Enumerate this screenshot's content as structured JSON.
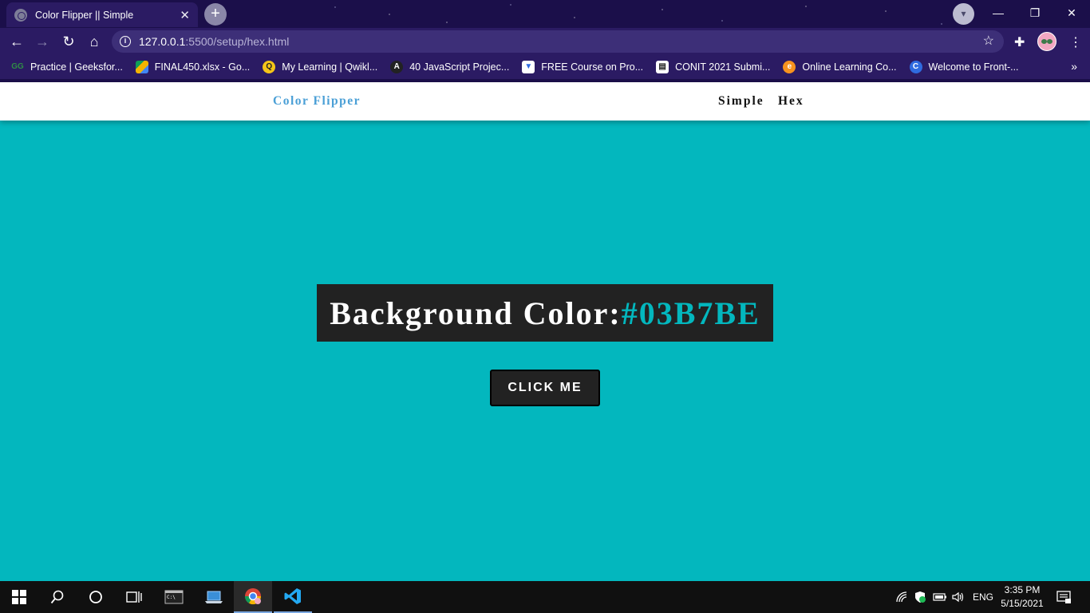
{
  "browser": {
    "tab_title": "Color Flipper || Simple",
    "tab_close": "✕",
    "new_tab": "+",
    "url_host": "127.0.0.1",
    "url_path": ":5500/setup/hex.html",
    "bookmarks": [
      {
        "label": "Practice | Geeksfor...",
        "icon": "geeksforgeeks-icon",
        "color": "#2f8d46"
      },
      {
        "label": "FINAL450.xlsx - Go...",
        "icon": "google-drive-icon",
        "color": "#f4b400"
      },
      {
        "label": "My Learning | Qwikl...",
        "icon": "qwiklabs-icon",
        "color": "#f5c518"
      },
      {
        "label": "40 JavaScript Projec...",
        "icon": "react-icon",
        "color": "#222222"
      },
      {
        "label": "FREE Course on Pro...",
        "icon": "course-icon",
        "color": "#ffffff"
      },
      {
        "label": "CONIT 2021 Submi...",
        "icon": "document-icon",
        "color": "#ffffff"
      },
      {
        "label": "Online Learning Co...",
        "icon": "edureka-icon",
        "color": "#f7931e"
      },
      {
        "label": "Welcome to Front-...",
        "icon": "c-icon",
        "color": "#2f6be0"
      }
    ]
  },
  "page": {
    "brand": "Color Flipper",
    "nav_links": [
      "Simple",
      "Hex"
    ],
    "color_label": "Background Color:",
    "color_value": "#03B7BE",
    "button_label": "CLICK ME",
    "background_color": "#03B7BE"
  },
  "taskbar": {
    "lang": "ENG",
    "time": "3:35 PM",
    "date": "5/15/2021"
  }
}
